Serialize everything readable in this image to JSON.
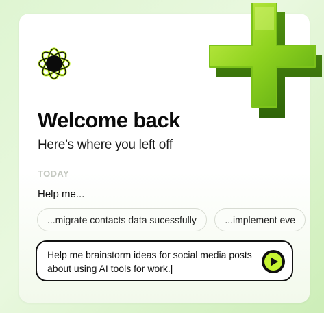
{
  "welcome": {
    "title": "Welcome back",
    "subtitle": "Here’s where you left off"
  },
  "history": {
    "section_label": "TODAY",
    "prompt_prefix": "Help me..."
  },
  "suggestions": [
    {
      "label": "...migrate contacts data sucessfully"
    },
    {
      "label": "...implement eve"
    }
  ],
  "composer": {
    "value": "Help me brainstorm ideas for social media posts about using AI tools for work.|"
  },
  "icons": {
    "logo": "flower-orbit-logo",
    "send": "play-triangle-icon",
    "decoration": "green-plus-icon"
  },
  "colors": {
    "accent": "#c6f432",
    "ink": "#0b0b0b",
    "section_label": "#c4c8c0"
  }
}
